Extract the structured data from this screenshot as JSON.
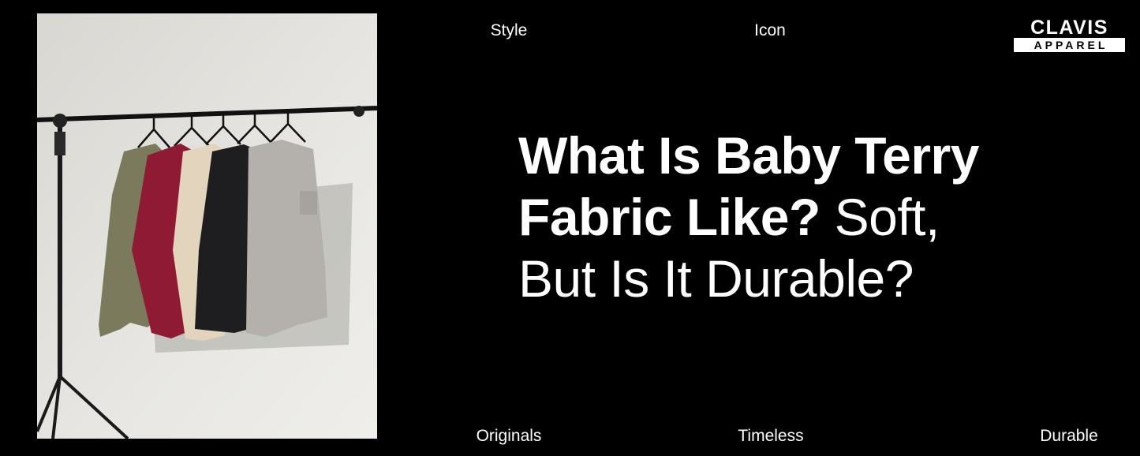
{
  "brand": {
    "line1": "CLAVIS",
    "line2": "APPAREL"
  },
  "top_words": [
    "Style",
    "Icon"
  ],
  "bottom_words": [
    "Originals",
    "Timeless",
    "Durable"
  ],
  "headline": {
    "bold_line1": "What Is Baby Terry",
    "bold_line2": "Fabric Like?",
    "light_line2": " Soft,",
    "light_line3": "But Is It Durable?"
  },
  "colors": {
    "background": "#000000",
    "text": "#ffffff",
    "shirts": [
      "#7b7a5c",
      "#8e1b33",
      "#e3d4bd",
      "#1e1e20",
      "#b4b1ad"
    ]
  }
}
